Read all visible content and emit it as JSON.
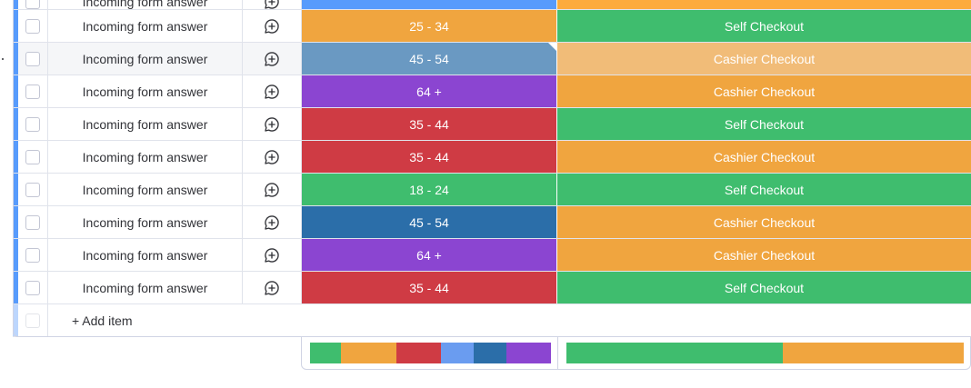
{
  "rows": [
    {
      "name": "Incoming form answer",
      "age": "",
      "checkout": "",
      "age_color": "#579bfc",
      "checkout_color": "#fdab3d"
    },
    {
      "name": "Incoming form answer",
      "age": "25 - 34",
      "checkout": "Self Checkout",
      "age_color": "#f0a53f",
      "checkout_color": "#3fbd6e"
    },
    {
      "name": "Incoming form answer",
      "age": "45 - 54",
      "checkout": "Cashier Checkout",
      "age_color": "#6a99c2",
      "checkout_color": "#f1bc78"
    },
    {
      "name": "Incoming form answer",
      "age": "64 +",
      "checkout": "Cashier Checkout",
      "age_color": "#8b45d1",
      "checkout_color": "#f0a53f"
    },
    {
      "name": "Incoming form answer",
      "age": "35 - 44",
      "checkout": "Self Checkout",
      "age_color": "#cf3b44",
      "checkout_color": "#3fbd6e"
    },
    {
      "name": "Incoming form answer",
      "age": "35 - 44",
      "checkout": "Cashier Checkout",
      "age_color": "#cf3b44",
      "checkout_color": "#f0a53f"
    },
    {
      "name": "Incoming form answer",
      "age": "18 - 24",
      "checkout": "Self Checkout",
      "age_color": "#3fbd6e",
      "checkout_color": "#3fbd6e"
    },
    {
      "name": "Incoming form answer",
      "age": "45 - 54",
      "checkout": "Cashier Checkout",
      "age_color": "#2b6ea9",
      "checkout_color": "#f0a53f"
    },
    {
      "name": "Incoming form answer",
      "age": "64 +",
      "checkout": "Cashier Checkout",
      "age_color": "#8b45d1",
      "checkout_color": "#f0a53f"
    },
    {
      "name": "Incoming form answer",
      "age": "35 - 44",
      "checkout": "Self Checkout",
      "age_color": "#cf3b44",
      "checkout_color": "#3fbd6e"
    }
  ],
  "add_item_label": "+ Add item",
  "summary": {
    "age_distribution": [
      {
        "color": "#3fbd6e",
        "fraction": 0.13
      },
      {
        "color": "#f0a53f",
        "fraction": 0.23
      },
      {
        "color": "#cf3b44",
        "fraction": 0.185
      },
      {
        "color": "#6a9cf0",
        "fraction": 0.135
      },
      {
        "color": "#2b6ea9",
        "fraction": 0.135
      },
      {
        "color": "#8b45d1",
        "fraction": 0.185
      }
    ],
    "checkout_distribution": [
      {
        "color": "#3fbd6e",
        "fraction": 0.545
      },
      {
        "color": "#f0a53f",
        "fraction": 0.455
      }
    ]
  },
  "colors": {
    "group_accent": "#579bfc",
    "grid_line": "#e0e3eb",
    "text": "#323338"
  }
}
